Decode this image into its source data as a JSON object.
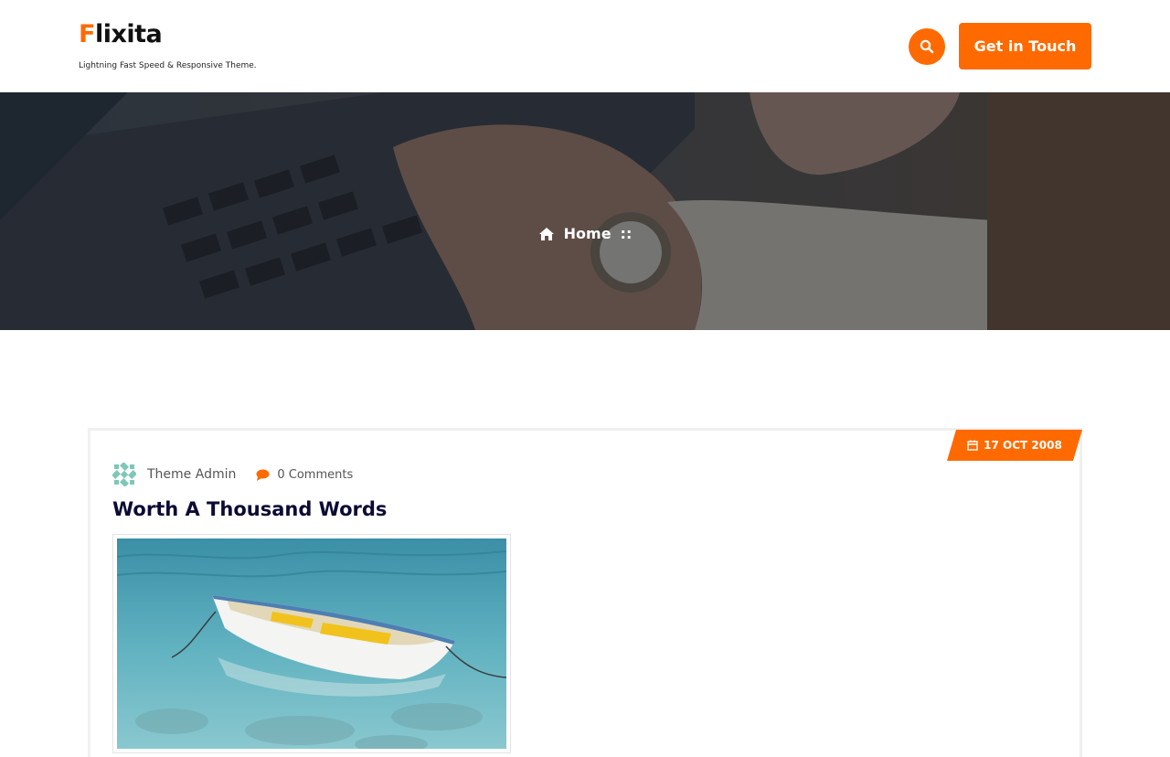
{
  "site": {
    "logo_first": "F",
    "logo_rest": "lixita",
    "tagline": "Lightning Fast Speed & Responsive Theme."
  },
  "header": {
    "cta_label": "Get in Touch",
    "search_icon": "search-icon"
  },
  "hero": {
    "breadcrumb_home": "Home",
    "breadcrumb_separator": "::",
    "home_icon": "home-icon"
  },
  "post": {
    "date": "17 OCT 2008",
    "author": "Theme Admin",
    "comments": "0 Comments",
    "title": "Worth A Thousand Words"
  },
  "colors": {
    "accent": "#ff6a00",
    "title": "#0b0b35"
  }
}
